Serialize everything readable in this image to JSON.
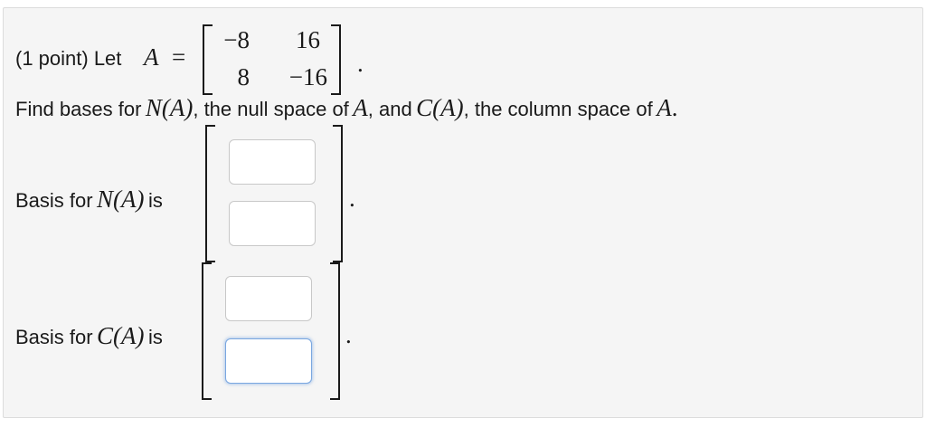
{
  "problem": {
    "line1_prefix": "(1 point) Let",
    "matrix_name": "A",
    "equals": "=",
    "matrix": [
      [
        "−8",
        "16"
      ],
      [
        "8",
        "−16"
      ]
    ],
    "period": "."
  },
  "question": {
    "t1": "Find bases for",
    "N_A": "N(A)",
    "t2": ", the null space of",
    "A1": "A",
    "t3": ", and",
    "C_A": "C(A)",
    "t4": ", the column space of",
    "A2": "A",
    "t5": "."
  },
  "null_basis": {
    "label_prefix": "Basis for",
    "label_math": "N(A)",
    "label_suffix": "is",
    "entries": [
      "",
      ""
    ],
    "period": "."
  },
  "col_basis": {
    "label_prefix": "Basis for",
    "label_math": "C(A)",
    "label_suffix": "is",
    "entries": [
      "",
      ""
    ],
    "period": "."
  },
  "colors": {
    "panel_bg": "#f5f5f5",
    "focus_border": "#7aa7e0"
  }
}
